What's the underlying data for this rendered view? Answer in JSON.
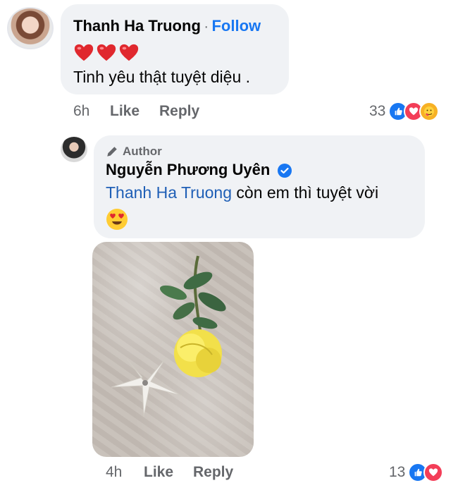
{
  "comment1": {
    "author": "Thanh Ha Truong",
    "separator": "·",
    "follow_label": "Follow",
    "hearts_count": 3,
    "text": "Tinh yêu thật tuyệt diệu .",
    "time": "6h",
    "like_label": "Like",
    "reply_label": "Reply",
    "reaction_count": "33",
    "reactions": [
      "like",
      "love",
      "care"
    ]
  },
  "reply1": {
    "author_badge": "Author",
    "author": "Nguyễn Phương Uyên",
    "mention": "Thanh Ha Truong",
    "text": " còn em thì tuyệt vời",
    "emoji": "heart-eyes",
    "time": "4h",
    "like_label": "Like",
    "reply_label": "Reply",
    "reaction_count": "13",
    "reactions": [
      "like",
      "love"
    ]
  },
  "colors": {
    "bubble": "#f0f2f5",
    "link": "#1877f2",
    "meta": "#65676b"
  }
}
